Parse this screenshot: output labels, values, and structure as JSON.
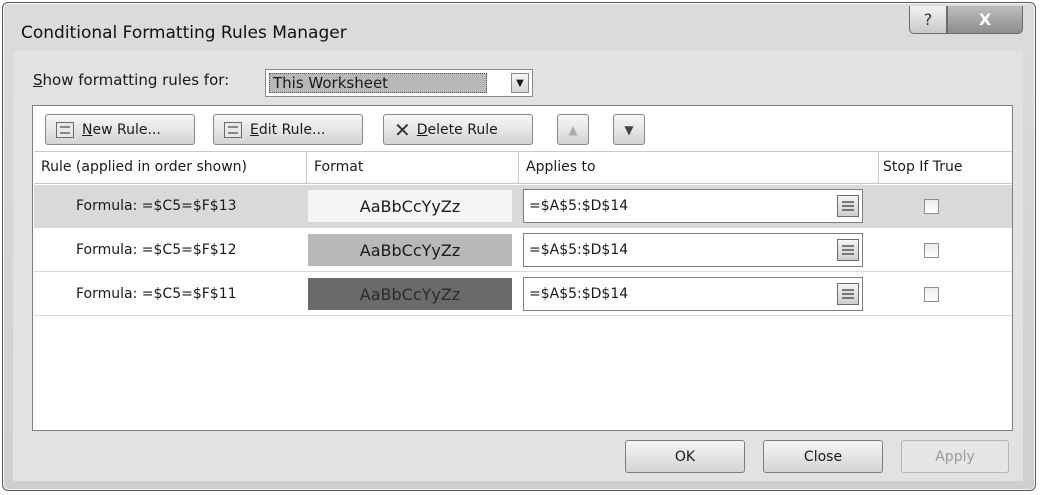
{
  "window": {
    "title": "Conditional Formatting Rules Manager",
    "help_glyph": "?",
    "close_glyph": "X"
  },
  "show_rules": {
    "label_first_letter": "S",
    "label_rest": "how formatting rules for:",
    "selected_value": "This Worksheet"
  },
  "toolbar": {
    "new_rule_u": "N",
    "new_rule_rest": "ew Rule...",
    "edit_rule_u": "E",
    "edit_rule_rest": "dit Rule...",
    "delete_rule_u": "D",
    "delete_rule_rest": "elete Rule"
  },
  "columns": {
    "rule": "Rule (applied in order shown)",
    "format": "Format",
    "applies_to": "Applies to",
    "stop_if_true": "Stop If True"
  },
  "rules": [
    {
      "rule": "Formula: =$C5=$F$13",
      "format_preview": "AaBbCcYyZz",
      "format_bg": "#f5f5f5",
      "applies_to": "=$A$5:$D$14",
      "stop_if_true": false,
      "selected": true
    },
    {
      "rule": "Formula: =$C5=$F$12",
      "format_preview": "AaBbCcYyZz",
      "format_bg": "#b8b8b8",
      "applies_to": "=$A$5:$D$14",
      "stop_if_true": false,
      "selected": false
    },
    {
      "rule": "Formula: =$C5=$F$11",
      "format_preview": "AaBbCcYyZz",
      "format_bg": "#6a6a6a",
      "applies_to": "=$A$5:$D$14",
      "stop_if_true": false,
      "selected": false
    }
  ],
  "footer": {
    "ok": "OK",
    "close": "Close",
    "apply": "Apply"
  }
}
